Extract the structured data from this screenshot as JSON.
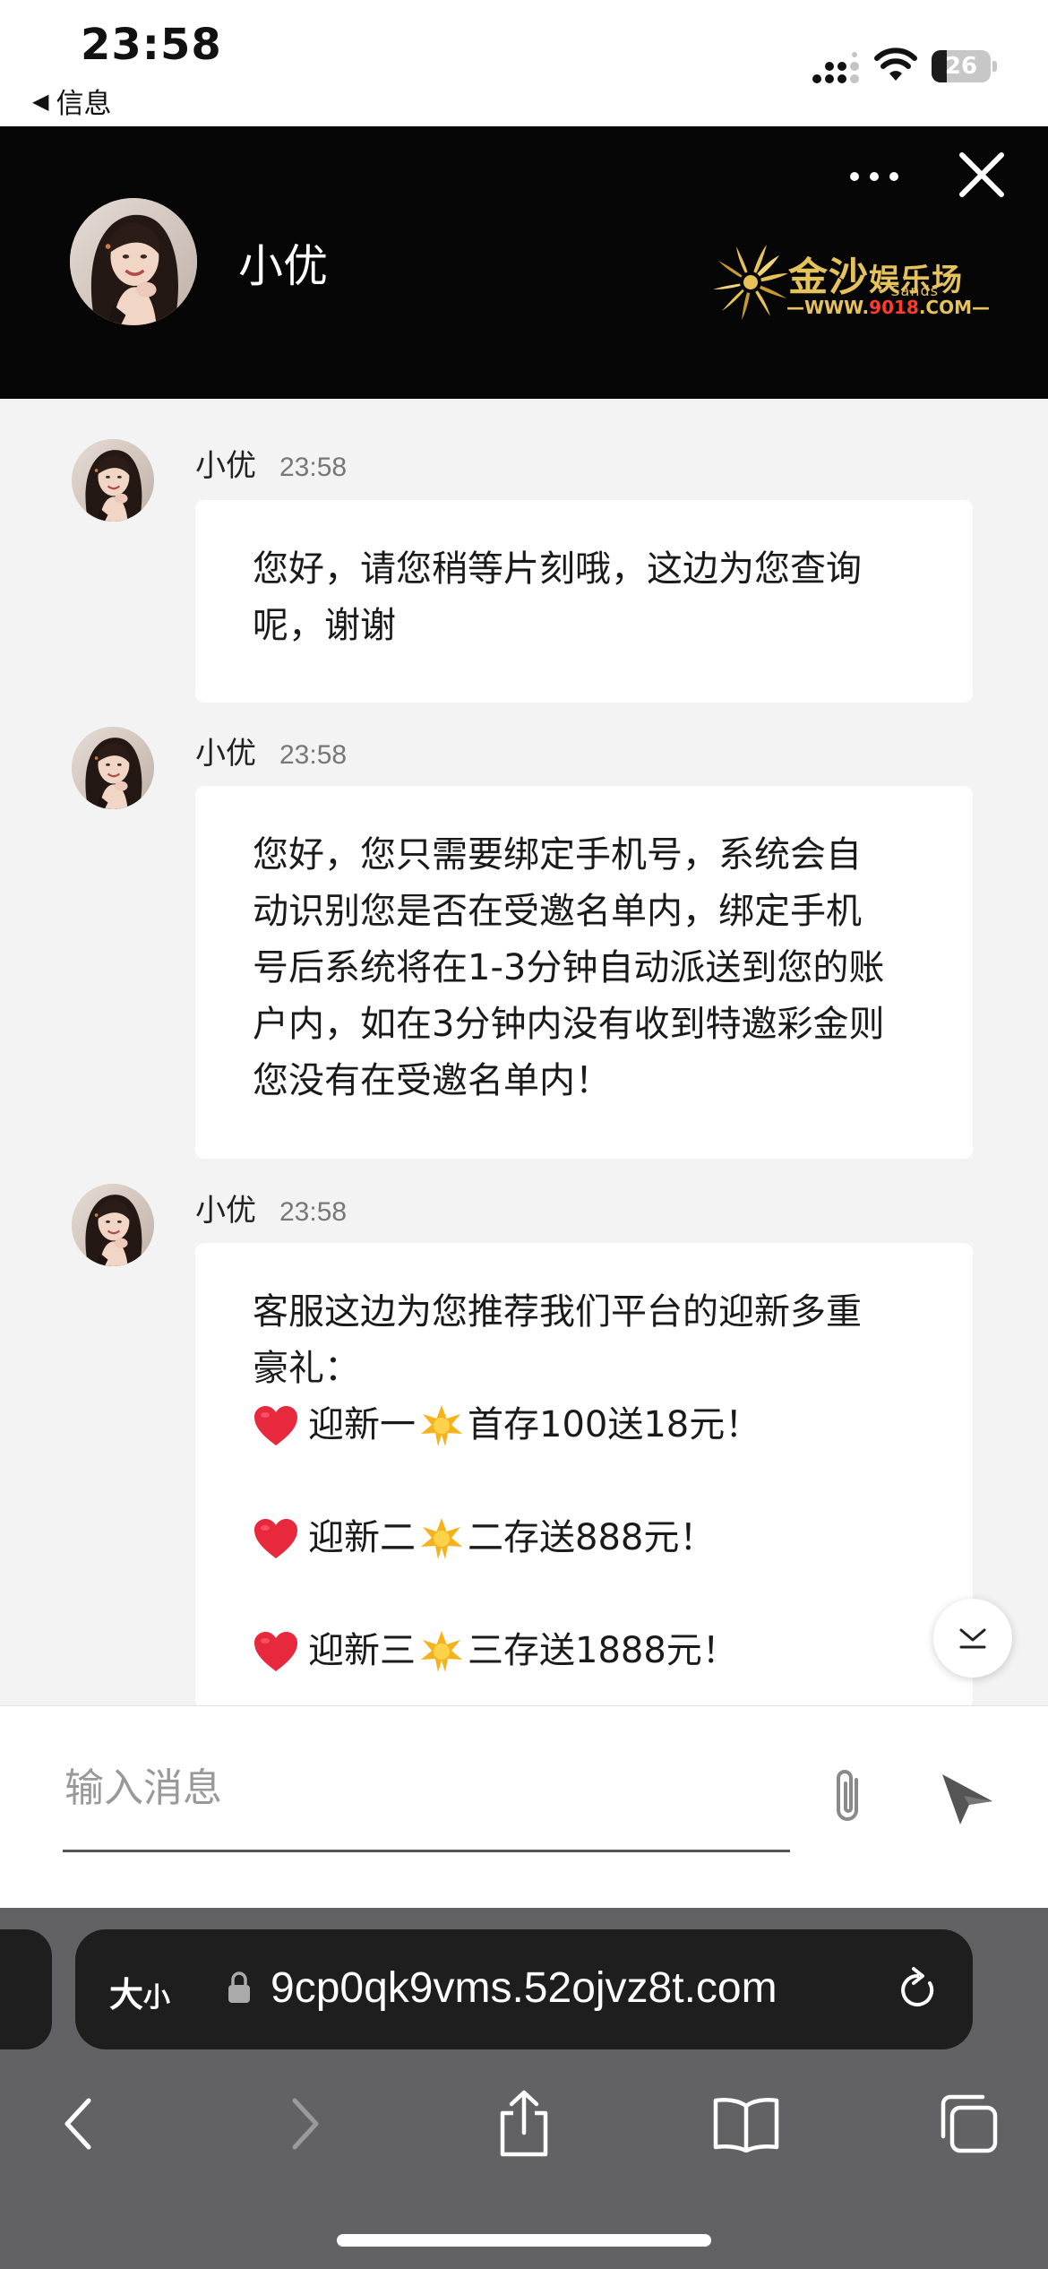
{
  "status_bar": {
    "time": "23:58",
    "back_label": "信息",
    "battery_level": "26",
    "battery_fraction": 0.26
  },
  "header": {
    "name": "小优",
    "logo": {
      "title": "金沙",
      "subtitle": "娱乐场",
      "sands": "· · Sands · ·",
      "url_prefix": "WWW.",
      "url_number": "9018",
      "url_suffix": ".COM"
    }
  },
  "messages": [
    {
      "sender": "小优",
      "time": "23:58",
      "text": "您好，请您稍等片刻哦，这边为您查询\n呢，谢谢"
    },
    {
      "sender": "小优",
      "time": "23:58",
      "text": "您好，您只需要绑定手机号，系统会自\n动识别您是否在受邀名单内，绑定手机\n号后系统将在1-3分钟自动派送到您的账\n户内，如在3分钟内没有收到特邀彩金则\n您没有在受邀名单内！"
    },
    {
      "sender": "小优",
      "time": "23:58",
      "intro": "客服这边为您推荐我们平台的迎新多重\n豪礼：",
      "promos": [
        {
          "name": "迎新一",
          "detail": "首存100送18元！"
        },
        {
          "name": "迎新二",
          "detail": "二存送888元！"
        },
        {
          "name": "迎新三",
          "detail": "三存送1888元！"
        }
      ]
    }
  ],
  "composer": {
    "placeholder": "输入消息",
    "value": ""
  },
  "browser": {
    "text_size_label": "大",
    "text_size_small": "小",
    "url": "9cp0qk9vms.52ojvz8t.com"
  },
  "icons": {
    "back": "chevron-left-icon",
    "forward": "chevron-right-icon",
    "share": "share-icon",
    "bookmarks": "book-icon",
    "tabs": "tabs-icon",
    "reload": "reload-icon",
    "attach": "paperclip-icon",
    "send": "send-icon",
    "more": "more-icon",
    "close": "close-icon"
  },
  "colors": {
    "header_bg": "#060606",
    "chat_bg": "#f3f3f3",
    "logo_gold": "#e6c25a",
    "heart_red": "#e8283c",
    "star_gold": "#f6b21a"
  }
}
